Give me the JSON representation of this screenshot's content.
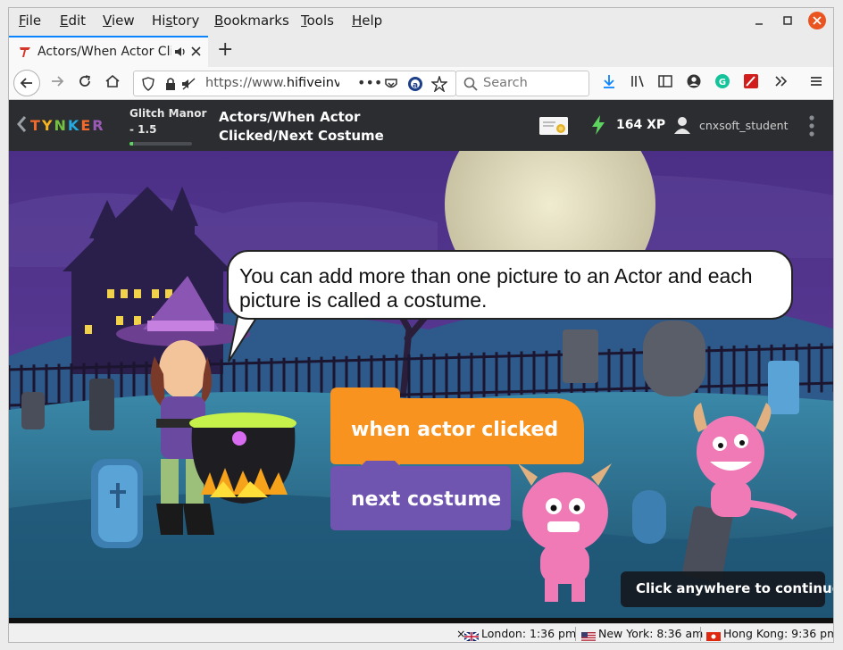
{
  "menu": {
    "items": [
      {
        "first": "F",
        "rest": "ile"
      },
      {
        "first": "E",
        "rest": "dit"
      },
      {
        "first": "V",
        "rest": "iew"
      },
      {
        "first": "Hi",
        "rest": "s",
        "tail": "tory",
        "ul_index": 2
      },
      {
        "first": "B",
        "rest": "ookmarks"
      },
      {
        "first": "T",
        "rest": "ools"
      },
      {
        "first": "H",
        "rest": "elp"
      }
    ],
    "labels": [
      "File",
      "Edit",
      "View",
      "History",
      "Bookmarks",
      "Tools",
      "Help"
    ]
  },
  "tab": {
    "title": "Actors/When Actor Cli",
    "new_tab": "+"
  },
  "nav": {
    "url_prefix": "https://www.",
    "url_host": "hifiveinv",
    "search_placeholder": "Search"
  },
  "tynker": {
    "logo": "TYNKER",
    "level_title": "Glitch Manor",
    "level_num": "- 1.5",
    "progress": 0.05,
    "lesson_line1": "Actors/When Actor",
    "lesson_line2": "Clicked/Next Costume",
    "xp": "164 XP",
    "username": "cnxsoft_student"
  },
  "scene": {
    "speech": "You can add more than one picture to an Actor and each picture is called a costume.",
    "block_when": "when actor clicked",
    "block_next": "next costume",
    "continue": "Click anywhere to continue"
  },
  "status": {
    "close": "×",
    "clocks": [
      {
        "city": "London: 1:36 pm"
      },
      {
        "city": "New York: 8:36 am"
      },
      {
        "city": "Hong Kong: 9:36 pm"
      }
    ]
  },
  "colors": {
    "tab_accent": "#0a84ff",
    "tynker_header": "#2b2d30",
    "block_orange": "#f7931e",
    "block_purple": "#6f55b0",
    "xp_green": "#5fd35f",
    "firefox_close": "#e95420"
  }
}
